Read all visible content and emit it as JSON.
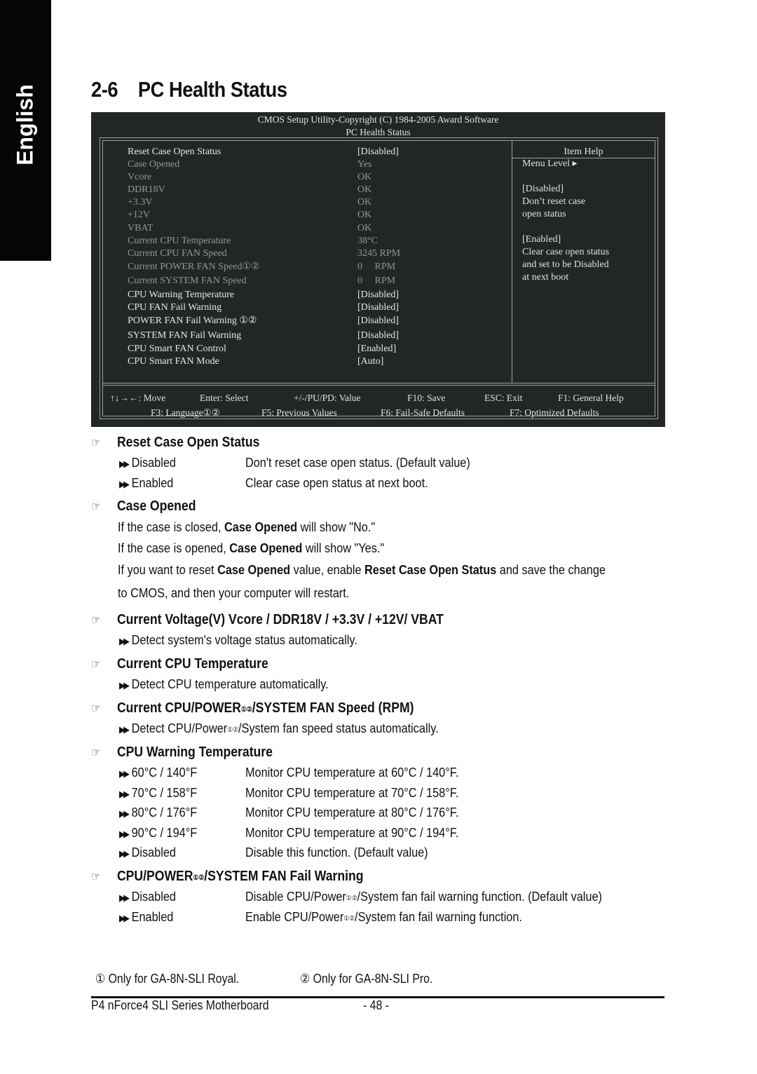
{
  "side_tab": "English",
  "section": {
    "number": "2-6",
    "title": "PC Health Status"
  },
  "bios": {
    "header_line1": "CMOS Setup Utility-Copyright (C) 1984-2005 Award Software",
    "header_line2": "PC Health Status",
    "rows": [
      {
        "label": "Reset Case Open Status",
        "value": "[Disabled]",
        "style": "bright"
      },
      {
        "label": "Case Opened",
        "value": "Yes",
        "style": "dim"
      },
      {
        "label": "Vcore",
        "value": "OK",
        "style": "dim"
      },
      {
        "label": "DDR18V",
        "value": "OK",
        "style": "dim"
      },
      {
        "label": "+3.3V",
        "value": "OK",
        "style": "dim"
      },
      {
        "label": "+12V",
        "value": "OK",
        "style": "dim"
      },
      {
        "label": "VBAT",
        "value": "OK",
        "style": "dim"
      },
      {
        "label": "Current CPU Temperature",
        "value": "38°C",
        "style": "dim"
      },
      {
        "label": "Current CPU FAN Speed",
        "value": "3245 RPM",
        "style": "dim"
      },
      {
        "label": "Current POWER FAN Speed①②",
        "value": "0     RPM",
        "style": "dim"
      },
      {
        "label": "Current SYSTEM FAN Speed",
        "value": "0     RPM",
        "style": "dim"
      },
      {
        "label": "CPU Warning Temperature",
        "value": "[Disabled]",
        "style": "bright"
      },
      {
        "label": "CPU FAN Fail Warning",
        "value": "[Disabled]",
        "style": "bright"
      },
      {
        "label": "POWER FAN Fail Warning ①②",
        "value": "[Disabled]",
        "style": "bright"
      },
      {
        "label": "SYSTEM FAN Fail Warning",
        "value": "[Disabled]",
        "style": "bright"
      },
      {
        "label": "CPU Smart FAN Control",
        "value": "[Enabled]",
        "style": "bright"
      },
      {
        "label": "CPU Smart FAN Mode",
        "value": "[Auto]",
        "style": "bright"
      }
    ],
    "help": {
      "title": "Item Help",
      "lines": [
        "Menu Level   ▸",
        "",
        "[Disabled]",
        "Don’t reset case",
        "open status",
        "",
        "[Enabled]",
        "Clear case open status",
        "and set to be Disabled",
        "at next boot"
      ]
    },
    "footer_line1": [
      "↑↓→←: Move",
      "Enter: Select",
      "+/-/PU/PD: Value",
      "F10: Save",
      "ESC: Exit",
      "F1: General Help"
    ],
    "footer_line2": [
      "F3: Language①②",
      "F5: Previous Values",
      "F6: Fail-Safe Defaults",
      "F7: Optimized Defaults"
    ]
  },
  "sections": {
    "reset_case": {
      "title": "Reset Case Open Status",
      "options": [
        {
          "key": "Disabled",
          "desc": "Don't reset case open status. (Default value)"
        },
        {
          "key": "Enabled",
          "desc": "Clear case open status at next boot."
        }
      ]
    },
    "case_opened": {
      "title": "Case Opened",
      "p1_pre": "If the case is closed, ",
      "p1_bold": "Case Opened",
      "p1_post": " will show \"No.\"",
      "p2_pre": "If the case is opened, ",
      "p2_bold": "Case Opened",
      "p2_post": " will show \"Yes.\"",
      "p3_a": "If you want to reset ",
      "p3_b": "Case Opened",
      "p3_c": " value, enable ",
      "p3_d": "Reset Case Open Status",
      "p3_e": " and save the change",
      "p4": "to CMOS, and then your computer will restart."
    },
    "voltage": {
      "title": "Current Voltage(V) Vcore / DDR18V / +3.3V / +12V/ VBAT",
      "desc": "Detect system's voltage status automatically."
    },
    "cpu_temp": {
      "title": "Current CPU Temperature",
      "desc": "Detect CPU temperature automatically."
    },
    "fan_speed": {
      "title_a": "Current CPU/POWER",
      "title_sup": "①②",
      "title_b": "/SYSTEM FAN Speed (RPM)",
      "desc_a": "Detect CPU/Power",
      "desc_sup": "①②",
      "desc_b": "/System fan speed status automatically."
    },
    "cpu_warn": {
      "title": "CPU Warning Temperature",
      "options": [
        {
          "key": "60°C / 140°F",
          "desc": "Monitor CPU temperature at 60°C / 140°F."
        },
        {
          "key": "70°C / 158°F",
          "desc": "Monitor CPU temperature at 70°C / 158°F."
        },
        {
          "key": "80°C / 176°F",
          "desc": "Monitor CPU temperature at 80°C / 176°F."
        },
        {
          "key": "90°C / 194°F",
          "desc": "Monitor CPU temperature at 90°C / 194°F."
        },
        {
          "key": "Disabled",
          "desc": "Disable this function. (Default value)"
        }
      ]
    },
    "fan_fail": {
      "title_a": "CPU/POWER",
      "title_sup": "①②",
      "title_b": "/SYSTEM FAN Fail Warning",
      "opt1_key": "Disabled",
      "opt1_a": "Disable CPU/Power",
      "opt1_sup": "①②",
      "opt1_b": "/System fan fail warning function. (Default value)",
      "opt2_key": "Enabled",
      "opt2_a": "Enable CPU/Power",
      "opt2_sup": "①②",
      "opt2_b": "/System fan fail warning function."
    }
  },
  "icons": {
    "hand": "☞",
    "double_arrow": "▶▶"
  },
  "footnotes": {
    "note1": "① Only for GA-8N-SLI Royal.",
    "note2": "② Only for GA-8N-SLI Pro."
  },
  "page_footer": {
    "product": "P4 nForce4 SLI Series Motherboard",
    "page": "- 48 -"
  }
}
